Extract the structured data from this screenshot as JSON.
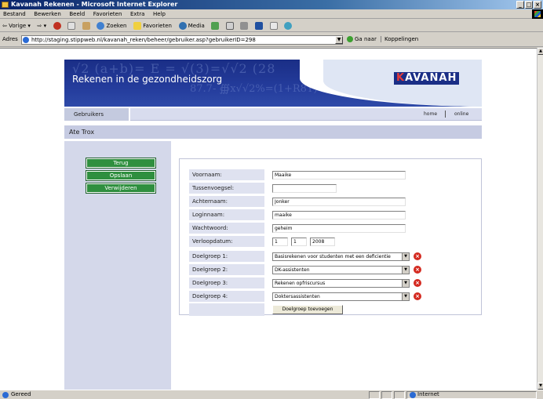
{
  "window": {
    "title": "Kavanah Rekenen - Microsoft Internet Explorer"
  },
  "menu": [
    "Bestand",
    "Bewerken",
    "Beeld",
    "Favorieten",
    "Extra",
    "Help"
  ],
  "toolbar": {
    "back": "⇦ Vorige ▾",
    "forward": "⇨ ▾",
    "search": "Zoeken",
    "favorites": "Favorieten",
    "media": "Media"
  },
  "address": {
    "label": "Adres",
    "url": "http://staging.stippweb.nl/kavanah_reken/beheer/gebruiker.asp?gebruikerID=298",
    "go": "Ga naar",
    "links": "Koppelingen"
  },
  "banner": {
    "title": "Rekenen in de gezondheidszorg",
    "logo_k": "K",
    "logo_rest": "AVANAH",
    "formula1": "√2 (a+b)= E = √(3)=√√2 (28",
    "formula2": "87.7- ∰x√√2%=(1+R8Y)+√72"
  },
  "nav": {
    "tab": "Gebruikers",
    "home": "home",
    "online": "online"
  },
  "user": {
    "name": "Ate Trox"
  },
  "sidebar": {
    "back": "Terug",
    "save": "Opslaan",
    "delete": "Verwijderen"
  },
  "form": {
    "voornaam_label": "Voornaam:",
    "voornaam": "Maaike",
    "tussenvoegsel_label": "Tussenvoegsel:",
    "tussenvoegsel": "",
    "achternaam_label": "Achternaam:",
    "achternaam": "Jonker",
    "loginnaam_label": "Loginnaam:",
    "loginnaam": "maaike",
    "wachtwoord_label": "Wachtwoord:",
    "wachtwoord": "geheim",
    "verloopdatum_label": "Verloopdatum:",
    "dag": "1",
    "maand": "1",
    "jaar": "2008",
    "doelgroep1_label": "Doelgroep 1:",
    "doelgroep1": "Basisrekenen voor studenten met een deficientie",
    "doelgroep2_label": "Doelgroep 2:",
    "doelgroep2": "DK-assistenten",
    "doelgroep3_label": "Doelgroep 3:",
    "doelgroep3": "Rekenen opfriscursus",
    "doelgroep4_label": "Doelgroep 4:",
    "doelgroep4": "Doktersassistenten",
    "add_button": "Doelgroep toevoegen"
  },
  "status": {
    "text": "Gereed",
    "zone": "Internet"
  }
}
